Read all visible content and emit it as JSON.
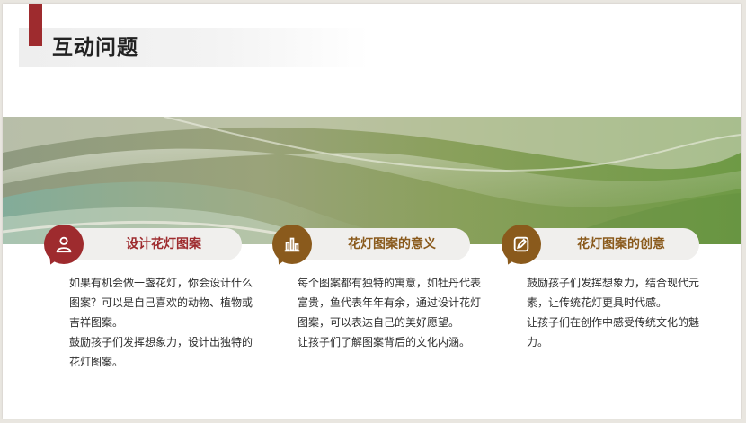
{
  "slide": {
    "title": "互动问题"
  },
  "colors": {
    "accent_red": "#9e2b2e",
    "accent_brown": "#8a5a1c"
  },
  "cards": [
    {
      "icon": "user-icon",
      "title": "设计花灯图案",
      "paragraphs": [
        "如果有机会做一盏花灯，你会设计什么图案？可以是自己喜欢的动物、植物或吉祥图案。",
        "鼓励孩子们发挥想象力，设计出独特的花灯图案。"
      ]
    },
    {
      "icon": "bar-chart-icon",
      "title": "花灯图案的意义",
      "paragraphs": [
        "每个图案都有独特的寓意，如牡丹代表富贵，鱼代表年年有余，通过设计花灯图案，可以表达自己的美好愿望。",
        "让孩子们了解图案背后的文化内涵。"
      ]
    },
    {
      "icon": "edit-icon",
      "title": "花灯图案的创意",
      "paragraphs": [
        "鼓励孩子们发挥想象力，结合现代元素，让传统花灯更具时代感。",
        "让孩子们在创作中感受传统文化的魅力。"
      ]
    }
  ]
}
